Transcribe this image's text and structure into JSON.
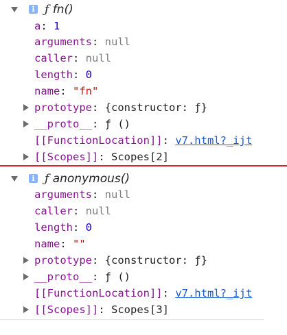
{
  "objects": [
    {
      "header": {
        "f_symbol": "ƒ",
        "name": "fn()"
      },
      "props": [
        {
          "key": "a",
          "value": "1",
          "kind": "number"
        },
        {
          "key": "arguments",
          "value": "null",
          "kind": "null"
        },
        {
          "key": "caller",
          "value": "null",
          "kind": "null"
        },
        {
          "key": "length",
          "value": "0",
          "kind": "number"
        },
        {
          "key": "name",
          "value": "\"fn\"",
          "kind": "string"
        }
      ],
      "prototype": {
        "key": "prototype",
        "value": "{constructor: ƒ}"
      },
      "proto": {
        "key": "__proto__",
        "value": "ƒ ()"
      },
      "location": {
        "key": "[[FunctionLocation]]",
        "value": "v7.html?_ijt"
      },
      "scopes": {
        "key": "[[Scopes]]",
        "value": "Scopes[2]"
      }
    },
    {
      "header": {
        "f_symbol": "ƒ",
        "name": "anonymous()"
      },
      "props": [
        {
          "key": "arguments",
          "value": "null",
          "kind": "null"
        },
        {
          "key": "caller",
          "value": "null",
          "kind": "null"
        },
        {
          "key": "length",
          "value": "0",
          "kind": "number"
        },
        {
          "key": "name",
          "value": "\"\"",
          "kind": "string"
        }
      ],
      "prototype": {
        "key": "prototype",
        "value": "{constructor: ƒ}"
      },
      "proto": {
        "key": "__proto__",
        "value": "ƒ ()"
      },
      "location": {
        "key": "[[FunctionLocation]]",
        "value": "v7.html?_ijt"
      },
      "scopes": {
        "key": "[[Scopes]]",
        "value": "Scopes[3]"
      }
    }
  ],
  "icons": {
    "info": "info-icon",
    "expand": "triangle-down-icon",
    "collapsed": "triangle-right-icon"
  },
  "colors": {
    "key": "#881391",
    "number": "#1c00cf",
    "string": "#c41a16",
    "null": "#808080",
    "link": "#1a5bd7",
    "divider": "#e0201b"
  }
}
